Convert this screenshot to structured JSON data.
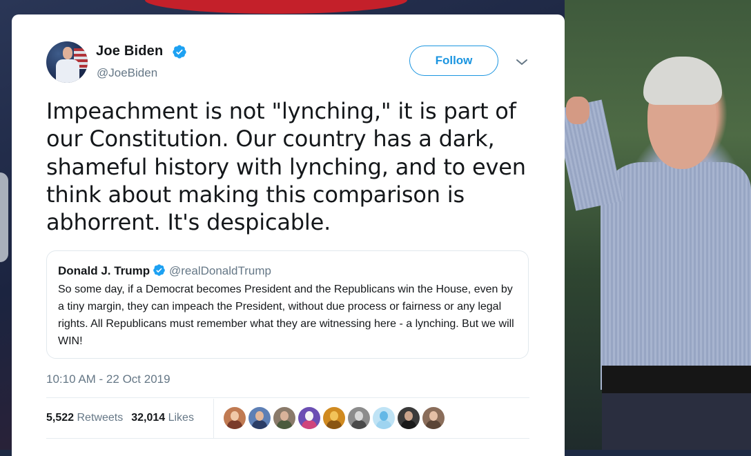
{
  "tweet": {
    "display_name": "Joe Biden",
    "handle": "@JoeBiden",
    "verified_icon": "verified-badge-icon",
    "follow_label": "Follow",
    "caret_icon": "chevron-down-icon",
    "text": "Impeachment is not \"lynching,\" it is part of our Constitution. Our country has a dark, shameful history with lynching, and to even think about making this comparison is abhorrent. It's despicable.",
    "timestamp": "10:10 AM - 22 Oct 2019",
    "retweets_count": "5,522",
    "retweets_label": "Retweets",
    "likes_count": "32,014",
    "likes_label": "Likes"
  },
  "quoted_tweet": {
    "display_name": "Donald J. Trump",
    "handle": "@realDonaldTrump",
    "text": "So some day, if a Democrat becomes President and the Republicans win the House, even by a tiny margin, they can impeach the President, without due process or fairness or any legal rights. All Republicans must remember what they are witnessing here - a lynching. But we will WIN!"
  },
  "likers": [
    {
      "bg": "#c07a52",
      "head": "#f0c8a8",
      "body": "#7a3b2a"
    },
    {
      "bg": "#5d7fb5",
      "head": "#e2b79b",
      "body": "#2a3d66"
    },
    {
      "bg": "#8a7a6a",
      "head": "#d9b29a",
      "body": "#4b5b3d"
    },
    {
      "bg": "#6b4fb3",
      "head": "#f4f4f4",
      "body": "#d0447c"
    },
    {
      "bg": "#d08a20",
      "head": "#f2c35a",
      "body": "#8a5512"
    },
    {
      "bg": "#8c8c8c",
      "head": "#d8d8d8",
      "body": "#4a4a4a"
    },
    {
      "bg": "#bfe3f5",
      "head": "#63b8e6",
      "body": "#9fd4f0"
    },
    {
      "bg": "#3a3a3a",
      "head": "#caa48c",
      "body": "#1a1a1a"
    },
    {
      "bg": "#8a6d5a",
      "head": "#e4bfa6",
      "body": "#5b4536"
    }
  ],
  "colors": {
    "accent": "#1b95e0",
    "verified": "#1da1f2",
    "text_primary": "#14171a",
    "text_secondary": "#657786"
  }
}
